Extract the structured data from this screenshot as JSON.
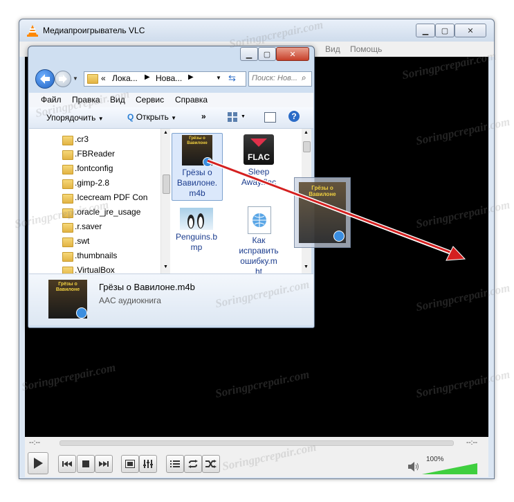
{
  "vlc": {
    "title": "Медиапроигрыватель VLC",
    "menu": [
      "Вид",
      "Помощь"
    ],
    "time_elapsed": "--:--",
    "time_total": "--:--",
    "volume": "100%",
    "volume_level": 1.0
  },
  "explorer": {
    "breadcrumb": [
      "Лока...",
      "Нова..."
    ],
    "breadcrumb_prefix": "«",
    "search_placeholder": "Поиск: Нов...",
    "menu": [
      "Файл",
      "Правка",
      "Вид",
      "Сервис",
      "Справка"
    ],
    "toolbar": {
      "organize": "Упорядочить",
      "open": "Открыть",
      "more": "»"
    },
    "tree": [
      ".cr3",
      ".FBReader",
      ".fontconfig",
      ".gimp-2.8",
      ".Icecream PDF Con",
      ".oracle_jre_usage",
      ".r.saver",
      ".swt",
      ".thumbnails",
      ".VirtualBox"
    ],
    "files": [
      {
        "name_line1": "Грёзы о",
        "name_line2": "Вавилоне.",
        "name_line3": "m4b"
      },
      {
        "name_line1": "Sleep",
        "name_line2": "Away.flac",
        "icon_text": "FLAC"
      },
      {
        "name_line1": "Penguins.b",
        "name_line2": "mp"
      },
      {
        "name_line1": "Как",
        "name_line2": "исправить",
        "name_line3": "ошибку.m",
        "name_line4": "ht"
      }
    ],
    "details": {
      "filename": "Грёзы о Вавилоне.m4b",
      "type": "AAC аудиокнига"
    }
  },
  "album_cover_title": "Грёзы о Вавилоне",
  "watermark": "Soringpcrepair.com",
  "colors": {
    "arrow": "#d42020",
    "video_bg": "#000000",
    "volume_green": "#3fcf3f"
  }
}
